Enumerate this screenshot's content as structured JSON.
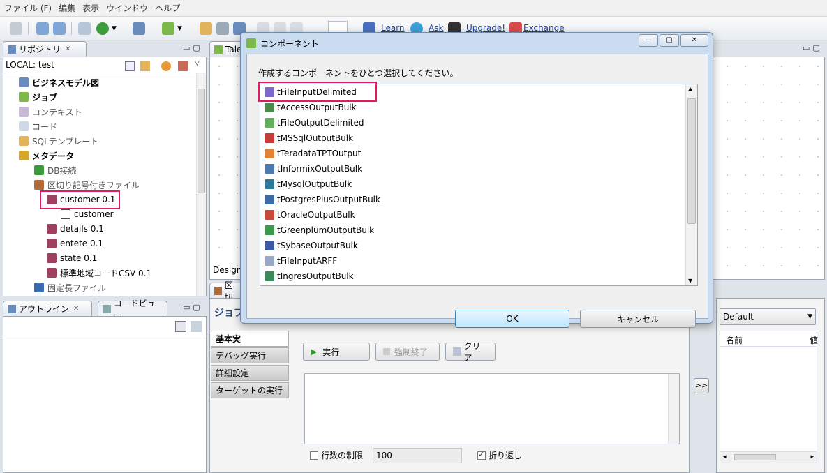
{
  "menu": [
    "ファイル (F)",
    "編集",
    "表示",
    "ウインドウ",
    "ヘルプ"
  ],
  "toolbar_links": {
    "learn": "Learn",
    "ask": "Ask",
    "upgrade": "Upgrade!",
    "exchange": "Exchange"
  },
  "repository": {
    "tab_title": "リポジトリ",
    "local": "LOCAL: test",
    "items": [
      {
        "label": "ビジネスモデル図"
      },
      {
        "label": "ジョブ"
      },
      {
        "label": "コンテキスト"
      },
      {
        "label": "コード"
      },
      {
        "label": "SQLテンプレート"
      },
      {
        "label": "メタデータ"
      },
      {
        "label": "DB接続"
      },
      {
        "label": "区切り記号付きファイル"
      },
      {
        "label": "customer 0.1"
      },
      {
        "label": "customer"
      },
      {
        "label": "details 0.1"
      },
      {
        "label": "entete 0.1"
      },
      {
        "label": "state 0.1"
      },
      {
        "label": "標準地域コードCSV 0.1"
      },
      {
        "label": "固定長ファイル"
      }
    ]
  },
  "outline": {
    "tab1": "アウトライン",
    "tab2": "コードビュー"
  },
  "editor": {
    "tab": "Tale",
    "design_tab": "Design"
  },
  "bottom": {
    "tab": "区切",
    "title": "ジョブ",
    "basic_run": "基本実",
    "side_tabs": [
      "デバッグ実行",
      "詳細設定",
      "ターゲットの実行"
    ],
    "run": "実行",
    "force_stop": "強制終了",
    "clear": "クリア",
    "line_limit_label": "行数の制限",
    "line_limit_value": "100",
    "wrap_label": "折り返し",
    "arrow": ">>"
  },
  "right_panel": {
    "dropdown": "Default",
    "col_name": "名前",
    "col_value": "値"
  },
  "dialog": {
    "title": "コンポーネント",
    "instruction": "作成するコンポーネントをひとつ選択してください。",
    "components": [
      "tFileInputDelimited",
      "tAccessOutputBulk",
      "tFileOutputDelimited",
      "tMSSqlOutputBulk",
      "tTeradataTPTOutput",
      "tInformixOutputBulk",
      "tMysqlOutputBulk",
      "tPostgresPlusOutputBulk",
      "tOracleOutputBulk",
      "tGreenplumOutputBulk",
      "tSybaseOutputBulk",
      "tFileInputARFF",
      "tIngresOutputBulk"
    ],
    "ok": "OK",
    "cancel": "キャンセル"
  },
  "colors": {
    "highlight": "#e8185c",
    "link": "#1f45a6"
  }
}
